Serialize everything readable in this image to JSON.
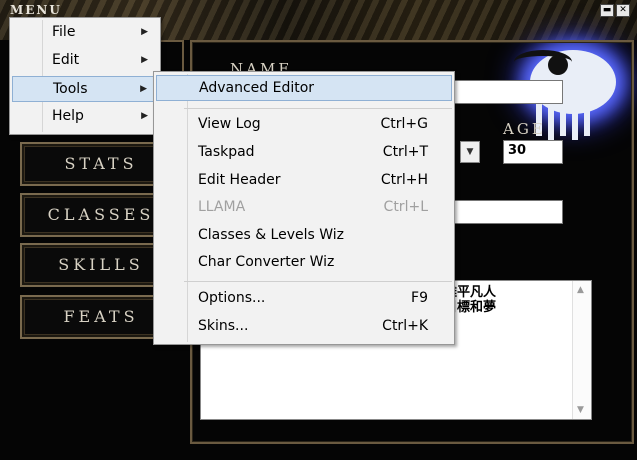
{
  "window": {
    "menu_label": "MENU",
    "minimize_glyph": "▬",
    "close_glyph": "✕"
  },
  "nav": {
    "buttons": [
      "STATS",
      "CLASSES",
      "SKILLS",
      "FEATS"
    ]
  },
  "form": {
    "name_label": "NAME",
    "name_value": "",
    "age_label": "AGE",
    "age_value": "30",
    "third_value": "",
    "description_text": "了要脫離平凡人\n你的的目標和夢\n為。"
  },
  "menus": {
    "main": [
      {
        "label": "File",
        "has_submenu": true
      },
      {
        "label": "Edit",
        "has_submenu": true
      },
      {
        "label": "Tools",
        "has_submenu": true,
        "highlighted": true
      },
      {
        "label": "Help",
        "has_submenu": true
      }
    ],
    "tools_submenu": [
      {
        "label": "Advanced Editor",
        "shortcut": "",
        "highlighted": true
      },
      {
        "label": "View Log",
        "shortcut": "Ctrl+G"
      },
      {
        "label": "Taskpad",
        "shortcut": "Ctrl+T"
      },
      {
        "label": "Edit Header",
        "shortcut": "Ctrl+H"
      },
      {
        "label": "LLAMA",
        "shortcut": "Ctrl+L",
        "disabled": true
      },
      {
        "label": "Classes & Levels Wiz",
        "shortcut": ""
      },
      {
        "label": "Char Converter Wiz",
        "shortcut": ""
      },
      {
        "label": "Options...",
        "shortcut": "F9"
      },
      {
        "label": "Skins...",
        "shortcut": "Ctrl+K"
      }
    ]
  },
  "icons": {
    "submenu_arrow": "▶",
    "dropdown_arrow": "▼",
    "scroll_up": "▲",
    "scroll_down": "▼"
  },
  "colors": {
    "menu_highlight": "#d5e4f3",
    "menu_bg": "#f2f2f2",
    "frame_gold": "#6a5a40",
    "disabled_text": "#a0a0a0"
  }
}
